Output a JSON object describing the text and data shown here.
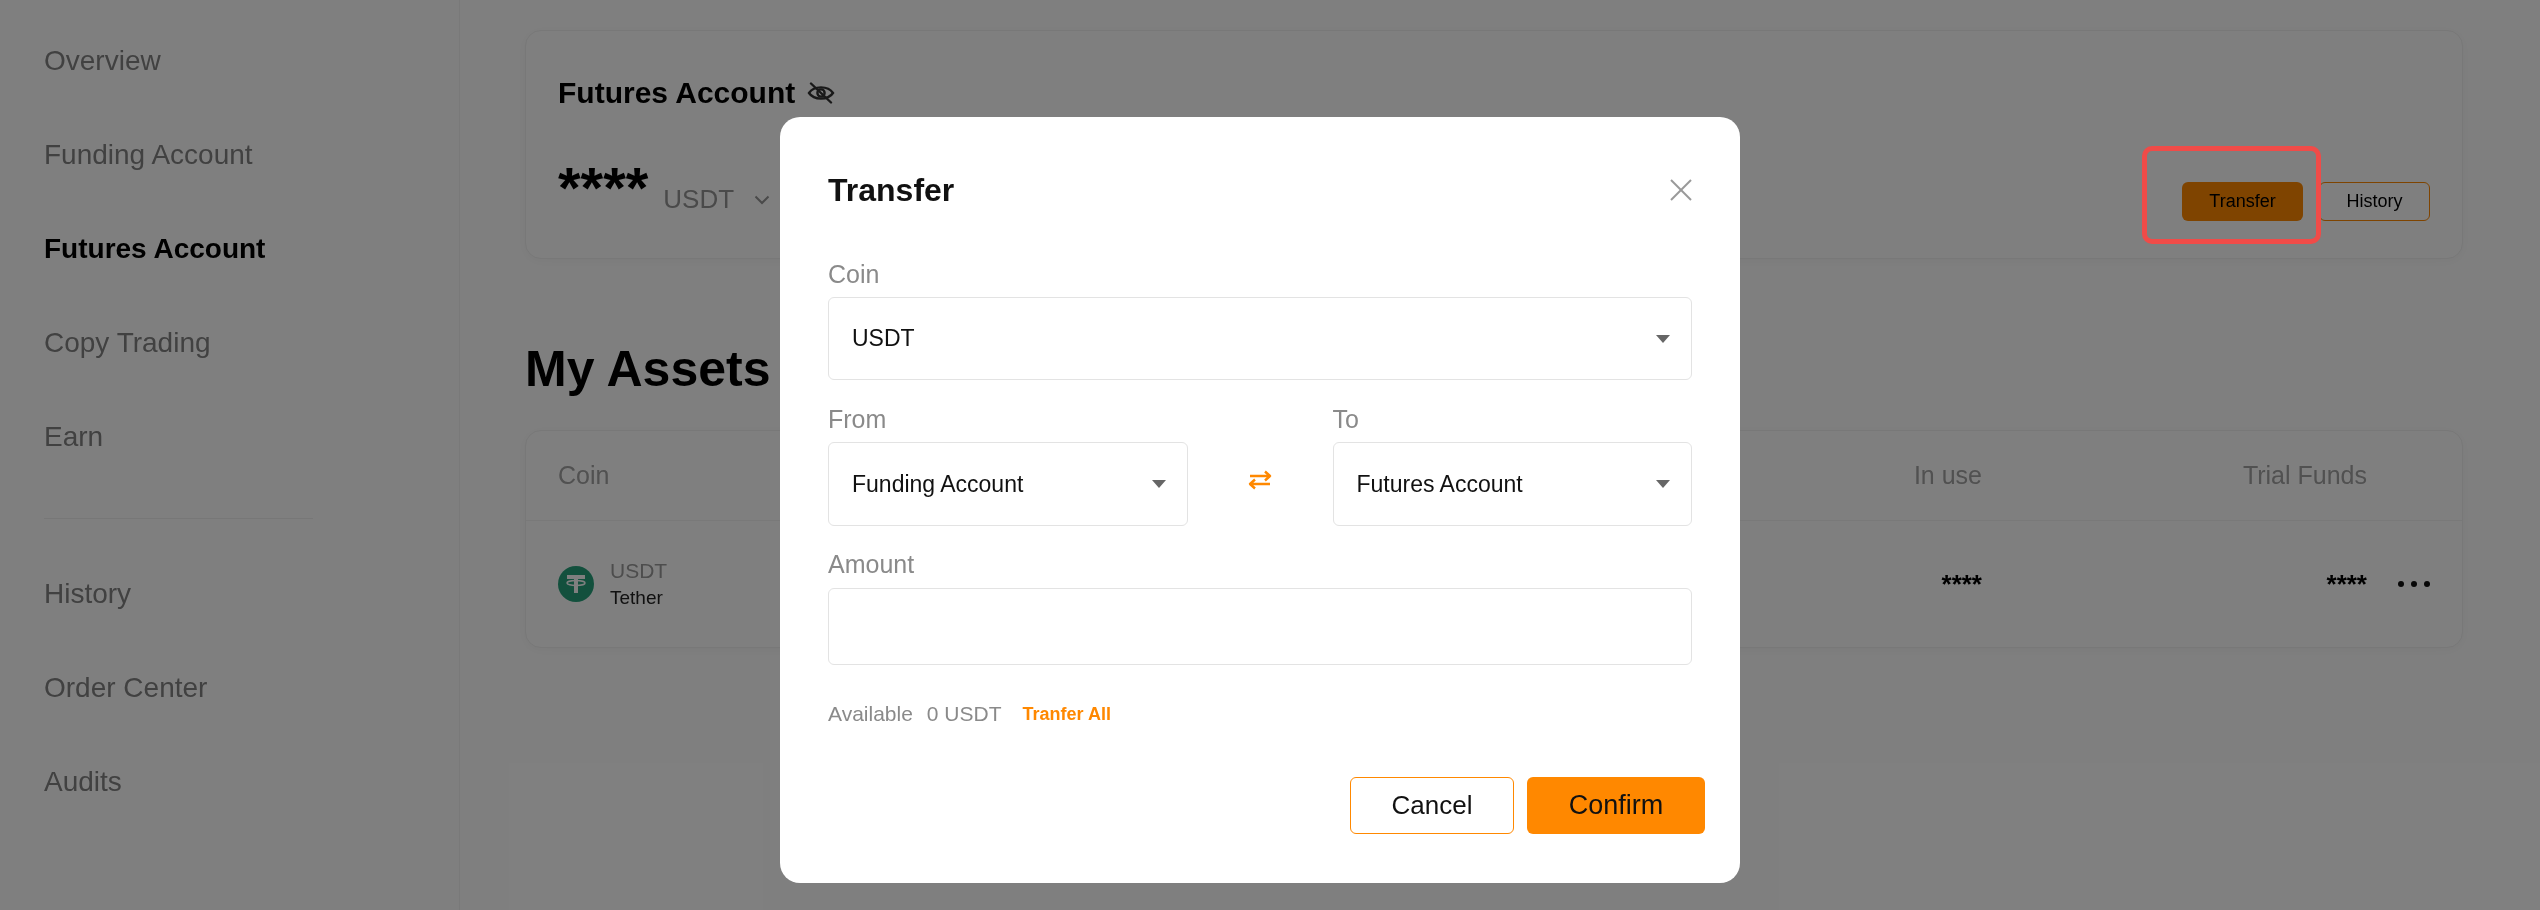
{
  "sidebar": {
    "sections": [
      {
        "items": [
          {
            "label": "Overview",
            "selected": false
          },
          {
            "label": "Funding Account",
            "selected": false
          },
          {
            "label": "Futures Account",
            "selected": true
          },
          {
            "label": "Copy Trading",
            "selected": false
          },
          {
            "label": "Earn",
            "selected": false
          }
        ]
      },
      {
        "items": [
          {
            "label": "History",
            "selected": false
          },
          {
            "label": "Order Center",
            "selected": false
          },
          {
            "label": "Audits",
            "selected": false
          }
        ]
      }
    ]
  },
  "account_card": {
    "title": "Futures Account",
    "balance": "****",
    "currency": "USDT",
    "buttons": [
      {
        "label": "Transfer",
        "kind": "primary",
        "highlighted": true
      },
      {
        "label": "History",
        "kind": "outline",
        "highlighted": false
      }
    ]
  },
  "assets": {
    "heading": "My Assets",
    "columns": [
      "Coin",
      "In use",
      "Trial Funds"
    ],
    "rows": [
      {
        "symbol": "USDT",
        "name": "Tether",
        "in_use": "****",
        "trial_funds": "****"
      }
    ]
  },
  "dialog": {
    "title": "Transfer",
    "coin": {
      "label": "Coin",
      "value": "USDT"
    },
    "from": {
      "label": "From",
      "value": "Funding Account"
    },
    "to": {
      "label": "To",
      "value": "Futures Account"
    },
    "amount": {
      "label": "Amount"
    },
    "available": {
      "label": "Available",
      "value": "0 USDT",
      "link": "Tranfer All"
    },
    "buttons": [
      {
        "label": "Cancel",
        "kind": "secondary"
      },
      {
        "label": "Confirm",
        "kind": "primary"
      }
    ]
  }
}
